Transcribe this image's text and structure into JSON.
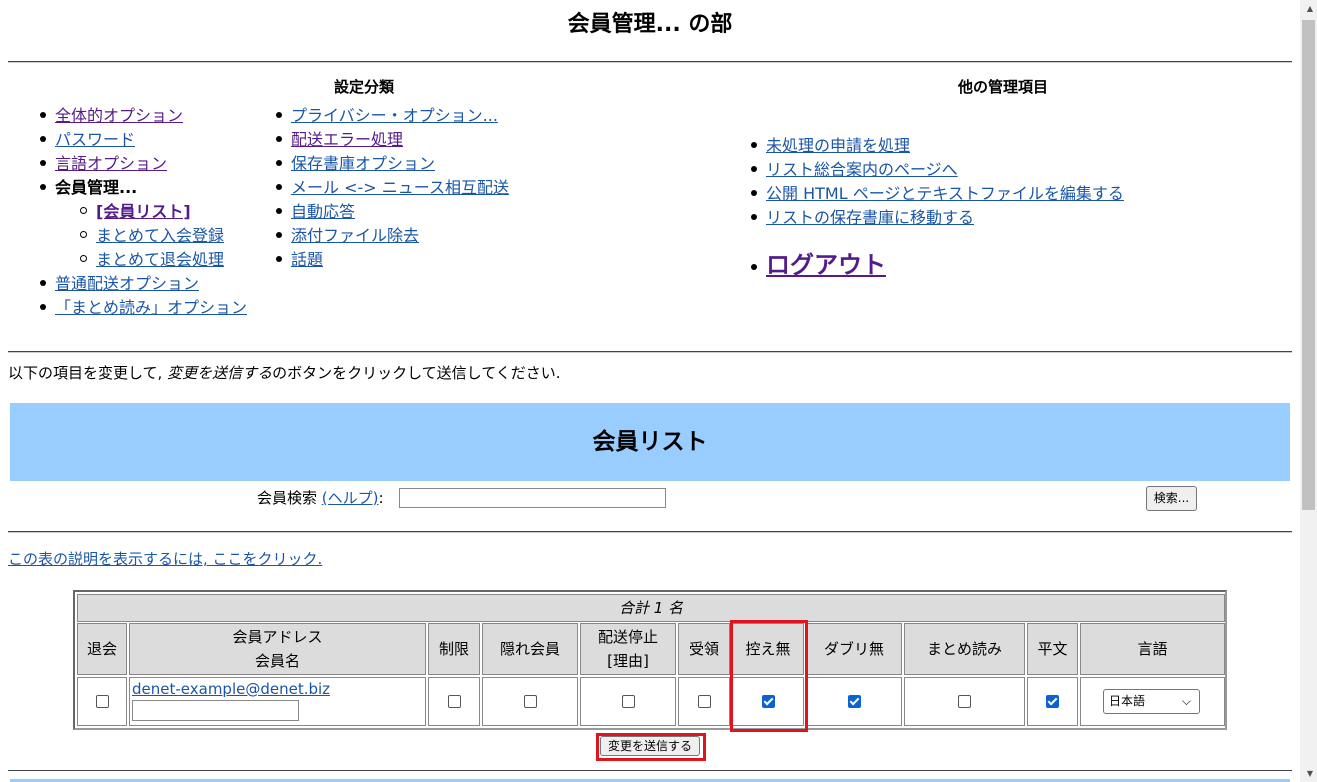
{
  "title": "会員管理... の部",
  "settings": {
    "heading": "設定分類",
    "col1": [
      "全体的オプション",
      "パスワード",
      "言語オプション"
    ],
    "current": "会員管理...",
    "sub": [
      "[会員リスト]",
      "まとめて入会登録",
      "まとめて退会処理"
    ],
    "col1b": [
      "普通配送オプション",
      "「まとめ読み」オプション"
    ],
    "col2": [
      "プライバシー・オプション...",
      "配送エラー処理",
      "保存書庫オプション",
      "メール <-> ニュース相互配送",
      "自動応答",
      "添付ファイル除去",
      "話題"
    ]
  },
  "other": {
    "heading": "他の管理項目",
    "links": [
      "未処理の申請を処理",
      "リスト総合案内のページへ",
      "公開 HTML ページとテキストファイルを編集する",
      "リストの保存書庫に移動する"
    ],
    "logout": "ログアウト"
  },
  "instruction": {
    "before": "以下の項目を変更して, ",
    "em": "変更を送信する",
    "after": "のボタンをクリックして送信してください."
  },
  "banner": "会員リスト",
  "search": {
    "label": "会員検索 ",
    "help": "(ヘルプ)",
    "colon": ":",
    "button": "検索..."
  },
  "help_link": "この表の説明を表示するには, ここをクリック.",
  "table": {
    "total": "合計 1 名",
    "headers": [
      "退会",
      "会員アドレス",
      "会員名",
      "制限",
      "隠れ会員",
      "配送停止",
      "[理由]",
      "受領",
      "控え無",
      "ダブリ無",
      "まとめ読み",
      "平文",
      "言語"
    ],
    "row": {
      "email": "denet-example@denet.biz",
      "name": "",
      "checks": {
        "unsub": false,
        "moderated": false,
        "hidden": false,
        "nomail": false,
        "ack": false,
        "not_metoo": true,
        "nodupes": true,
        "digest": false,
        "plain": true
      },
      "language": "日本語"
    }
  },
  "submit": "変更を送信する"
}
